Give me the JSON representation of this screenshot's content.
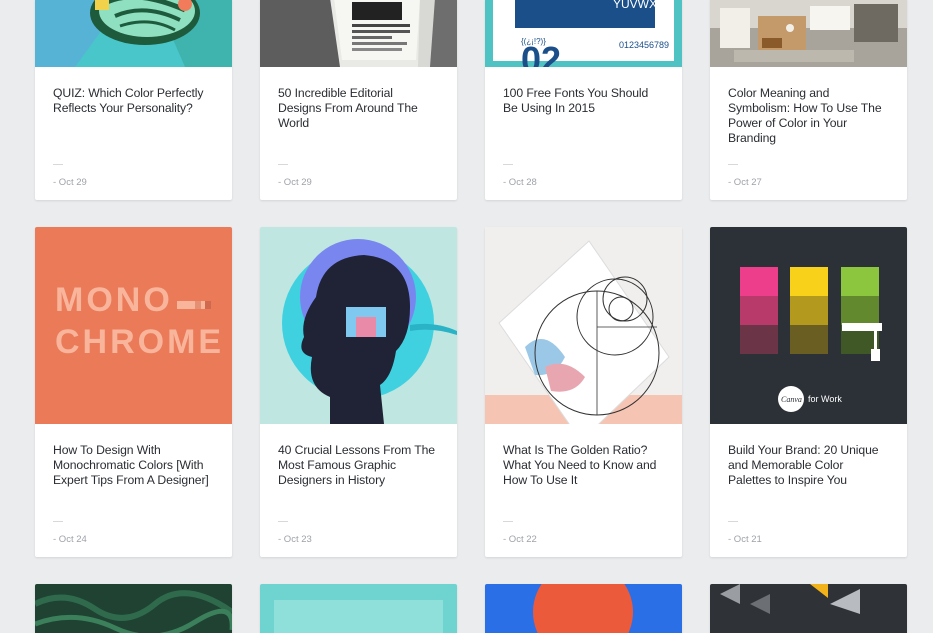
{
  "colors": {
    "page_background": "#ebecee",
    "card_background": "#ffffff",
    "title_text": "#2a2d33",
    "date_text": "#9ea2a9"
  },
  "cards": [
    {
      "title": "QUIZ: Which Color Perfectly Reflects Your Personality?",
      "date": "- Oct 29",
      "image": "colorful illustration on teal"
    },
    {
      "title": "50 Incredible Editorial Designs From Around The World",
      "date": "- Oct 29",
      "image": "newspaper stack"
    },
    {
      "title": "100 Free Fonts You Should Be Using In 2015",
      "date": "- Oct 28",
      "image": "font specimen poster",
      "image_text": [
        "YUVWXYZ",
        "{(¿¡!?)}",
        "0123456789",
        "02"
      ]
    },
    {
      "title": "Color Meaning and Symbolism: How To Use The Power of Color in Your Branding",
      "date": "- Oct 27",
      "image": "stationery flat lay"
    },
    {
      "title": "How To Design With Monochromatic Colors [With Expert Tips From A Designer]",
      "date": "- Oct 24",
      "image": "monochrome lettering on orange",
      "image_text": [
        "MONO",
        "CHROME"
      ]
    },
    {
      "title": "40 Crucial Lessons From The Most Famous Graphic Designers in History",
      "date": "- Oct 23",
      "image": "silhouette head with window"
    },
    {
      "title": "What Is The Golden Ratio? What You Need to Know and How To Use It",
      "date": "- Oct 22",
      "image": "golden spiral over illustration"
    },
    {
      "title": "Build Your Brand: 20 Unique and Memorable Color Palettes to Inspire You",
      "date": "- Oct 21",
      "image": "color palette swatches",
      "image_text": [
        "Canva",
        "for Work"
      ]
    },
    {
      "title": "",
      "date": "",
      "image": "green foliage"
    },
    {
      "title": "",
      "date": "",
      "image": "teal gradient"
    },
    {
      "title": "",
      "date": "",
      "image": "red circle on blue"
    },
    {
      "title": "",
      "date": "",
      "image": "geometric shapes on dark"
    }
  ]
}
